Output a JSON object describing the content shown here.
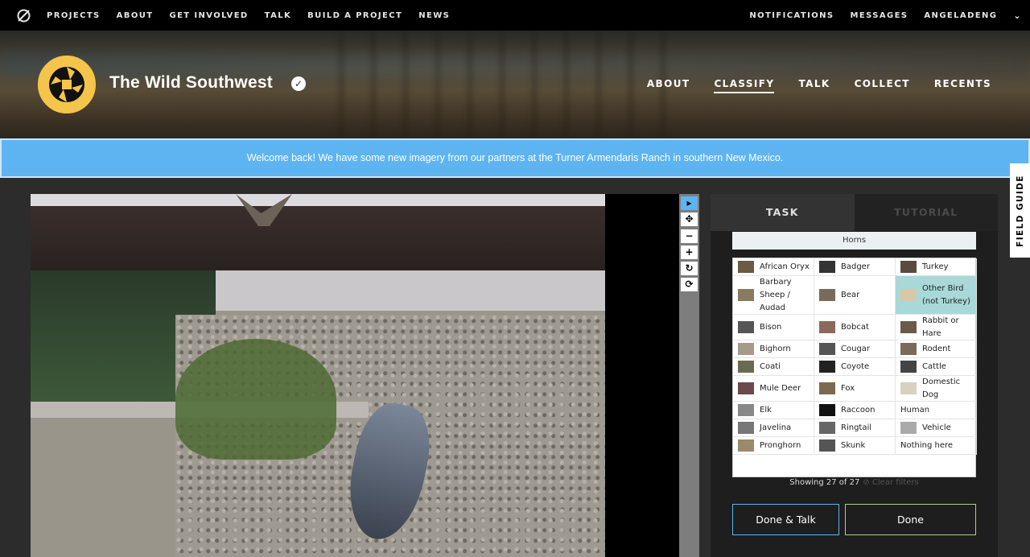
{
  "topnav": {
    "left": [
      "PROJECTS",
      "ABOUT",
      "GET INVOLVED",
      "TALK",
      "BUILD A PROJECT",
      "NEWS"
    ],
    "right": [
      "NOTIFICATIONS",
      "MESSAGES",
      "ANGELADENG"
    ]
  },
  "project": {
    "title": "The Wild Southwest",
    "nav": [
      "ABOUT",
      "CLASSIFY",
      "TALK",
      "COLLECT",
      "RECENTS"
    ],
    "active_nav": "CLASSIFY"
  },
  "banner": "Welcome back! We have some new imagery from our partners at the Turner Armendaris Ranch in southern New Mexico.",
  "panel": {
    "tabs": [
      "TASK",
      "TUTORIAL"
    ],
    "filter_label": "Horns",
    "choices": [
      "African Oryx",
      "Badger",
      "Turkey",
      "Barbary Sheep / Audad",
      "Bear",
      "Other Bird (not Turkey)",
      "Bison",
      "Bobcat",
      "Rabbit or Hare",
      "Bighorn",
      "Cougar",
      "Rodent",
      "Coati",
      "Coyote",
      "Cattle",
      "Mule Deer",
      "Fox",
      "Domestic Dog",
      "Elk",
      "Raccoon",
      "Human",
      "Javelina",
      "Ringtail",
      "Vehicle",
      "Pronghorn",
      "Skunk",
      "Nothing here"
    ],
    "selected": "Other Bird (not Turkey)",
    "showing": "Showing 27 of 27",
    "clear_filters": "Clear filters",
    "done_talk": "Done & Talk",
    "done": "Done"
  },
  "field_guide": "FIELD GUIDE",
  "colors": {
    "accent_blue": "#5eb4f0",
    "selected": "#a9d8d8",
    "done_border": "#a6d486",
    "avatar": "#f5c44a"
  }
}
